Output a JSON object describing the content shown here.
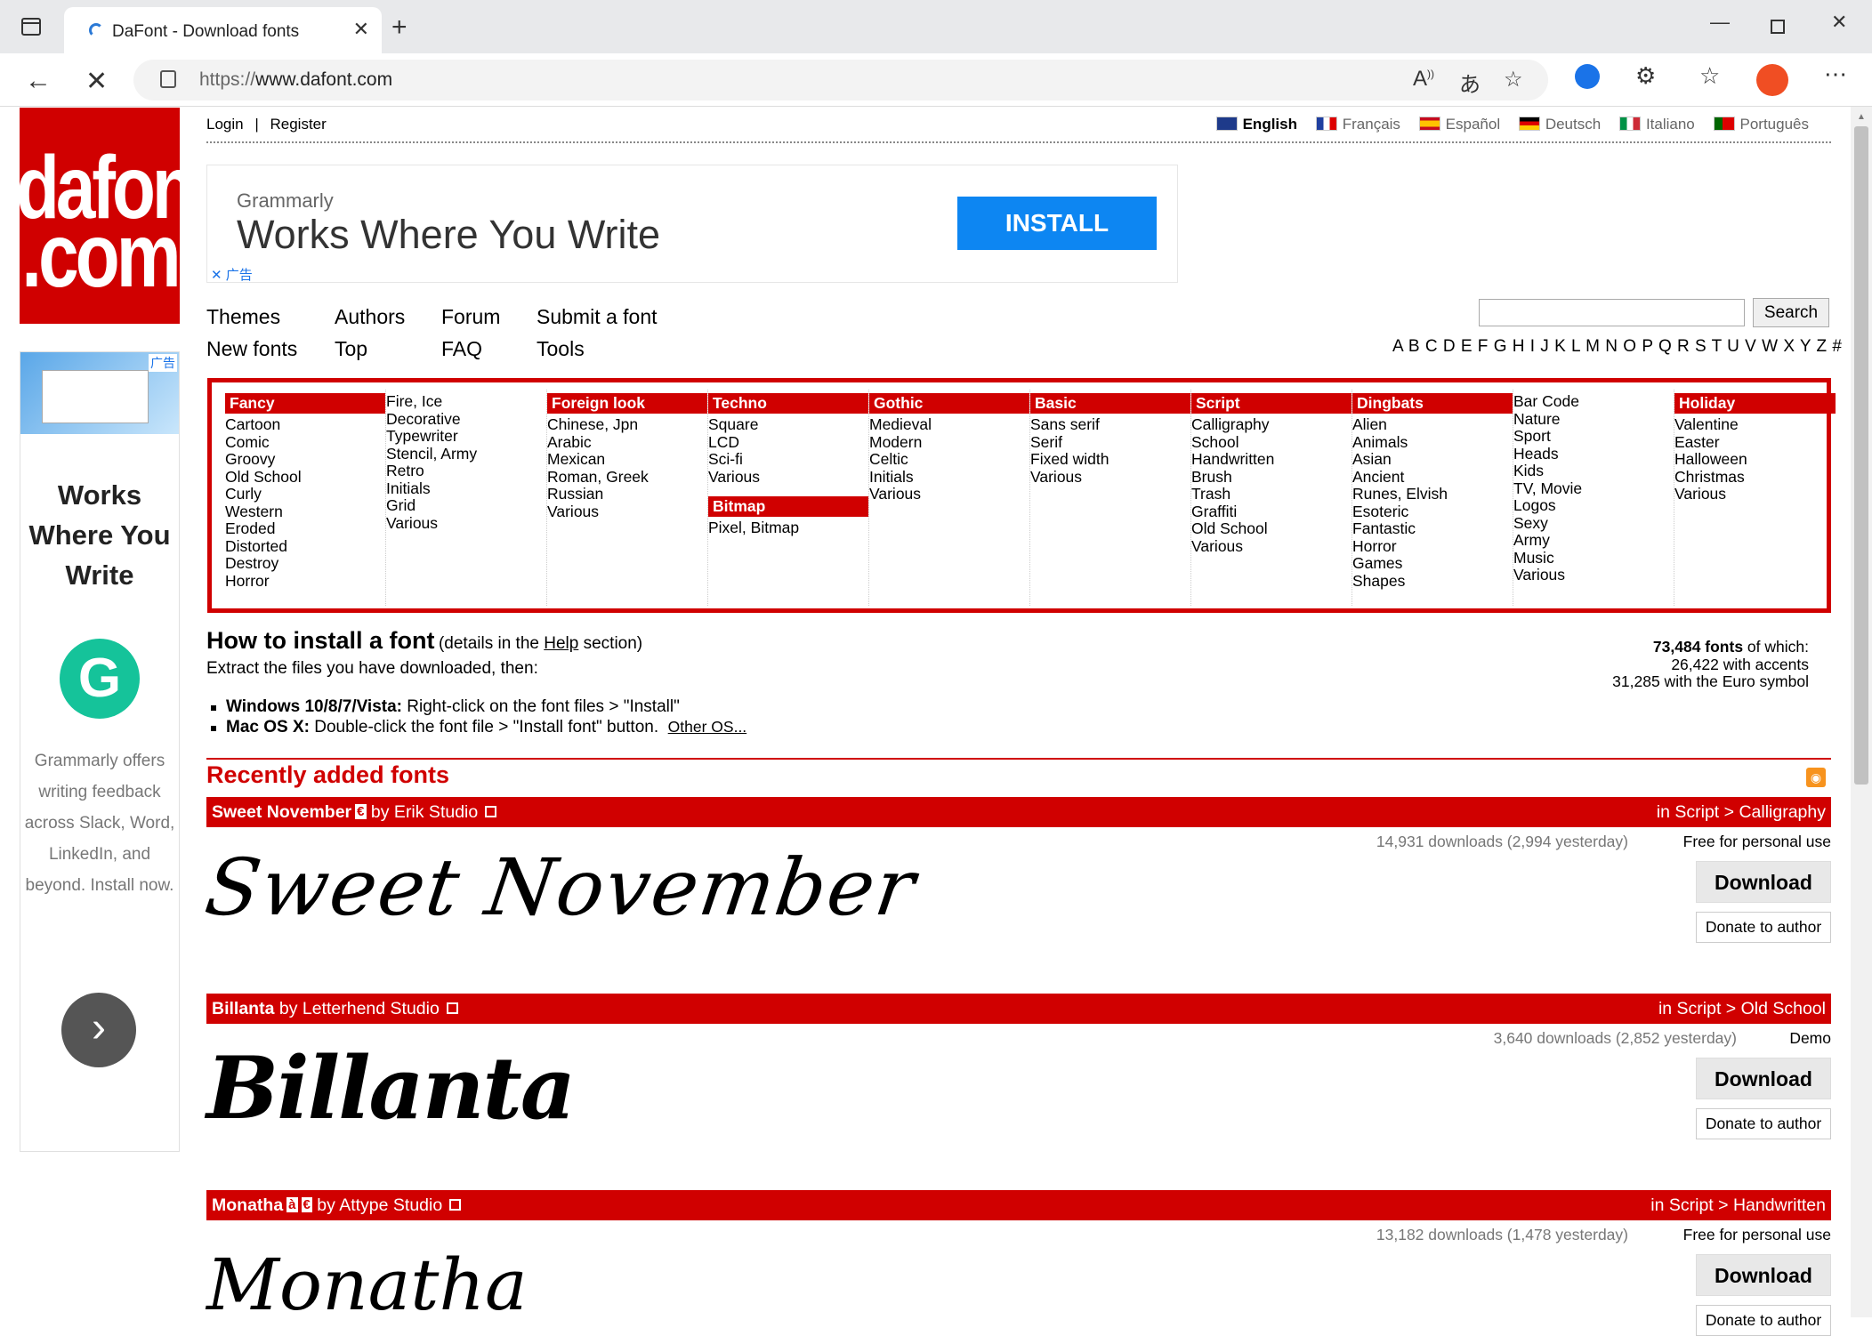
{
  "browser": {
    "tab_title": "DaFont - Download fonts",
    "url_proto": "https://",
    "url_host": "www.dafont.com"
  },
  "logo": {
    "line1": "dafont",
    "line2": ".com"
  },
  "side_ad": {
    "ad_tag": "广告",
    "headline": "Works Where You Write",
    "body": "Grammarly offers writing feedback across Slack, Word, LinkedIn, and beyond. Install now."
  },
  "top_links": {
    "login": "Login",
    "sep": "|",
    "register": "Register"
  },
  "languages": [
    "English",
    "Français",
    "Español",
    "Deutsch",
    "Italiano",
    "Português"
  ],
  "top_ad": {
    "brand": "Grammarly",
    "headline": "Works Where You Write",
    "button": "INSTALL",
    "ad_tag": "广告"
  },
  "nav": {
    "themes": "Themes",
    "new_fonts": "New fonts",
    "authors": "Authors",
    "top": "Top",
    "forum": "Forum",
    "faq": "FAQ",
    "submit": "Submit a font",
    "tools": "Tools"
  },
  "search": {
    "button": "Search",
    "value": ""
  },
  "alphabet": "A B C D E F G H I J K L M N O P Q R S T U V W X Y Z #",
  "categories": [
    {
      "sections": [
        {
          "title": "Fancy",
          "items": [
            "Cartoon",
            "Comic",
            "Groovy",
            "Old School",
            "Curly",
            "Western",
            "Eroded",
            "Distorted",
            "Destroy",
            "Horror"
          ]
        }
      ]
    },
    {
      "sections": [
        {
          "title": "",
          "items": [
            "Fire, Ice",
            "Decorative",
            "Typewriter",
            "Stencil, Army",
            "Retro",
            "Initials",
            "Grid",
            "Various"
          ]
        }
      ]
    },
    {
      "sections": [
        {
          "title": "Foreign look",
          "items": [
            "Chinese, Jpn",
            "Arabic",
            "Mexican",
            "Roman, Greek",
            "Russian",
            "Various"
          ]
        }
      ]
    },
    {
      "sections": [
        {
          "title": "Techno",
          "items": [
            "Square",
            "LCD",
            "Sci-fi",
            "Various"
          ]
        },
        {
          "title": "Bitmap",
          "items": [
            "Pixel, Bitmap"
          ]
        }
      ]
    },
    {
      "sections": [
        {
          "title": "Gothic",
          "items": [
            "Medieval",
            "Modern",
            "Celtic",
            "Initials",
            "Various"
          ]
        }
      ]
    },
    {
      "sections": [
        {
          "title": "Basic",
          "items": [
            "Sans serif",
            "Serif",
            "Fixed width",
            "Various"
          ]
        }
      ]
    },
    {
      "sections": [
        {
          "title": "Script",
          "items": [
            "Calligraphy",
            "School",
            "Handwritten",
            "Brush",
            "Trash",
            "Graffiti",
            "Old School",
            "Various"
          ]
        }
      ]
    },
    {
      "sections": [
        {
          "title": "Dingbats",
          "items": [
            "Alien",
            "Animals",
            "Asian",
            "Ancient",
            "Runes, Elvish",
            "Esoteric",
            "Fantastic",
            "Horror",
            "Games",
            "Shapes"
          ]
        }
      ]
    },
    {
      "sections": [
        {
          "title": "",
          "items": [
            "Bar Code",
            "Nature",
            "Sport",
            "Heads",
            "Kids",
            "TV, Movie",
            "Logos",
            "Sexy",
            "Army",
            "Music",
            "Various"
          ]
        }
      ]
    },
    {
      "sections": [
        {
          "title": "Holiday",
          "items": [
            "Valentine",
            "Easter",
            "Halloween",
            "Christmas",
            "Various"
          ]
        }
      ]
    }
  ],
  "howto": {
    "title": "How to install a font",
    "details_pre": "(details in the ",
    "details_link": "Help",
    "details_post": " section)",
    "extract": "Extract the files you have downloaded, then:",
    "win_label": "Windows 10/8/7/Vista:",
    "win_text": " Right-click on the font files > \"Install\"",
    "mac_label": "Mac OS X:",
    "mac_text": " Double-click the font file > \"Install font\" button.",
    "other": "Other OS..."
  },
  "stats": {
    "count": "73,484 fonts",
    "of_which": " of which:",
    "accents": "26,422 with accents",
    "euro": "31,285 with the Euro symbol"
  },
  "recent_title": "Recently added fonts",
  "fonts": [
    {
      "name": "Sweet November",
      "badges": [
        "€"
      ],
      "by": "by Erik Studio",
      "category": "in Script > Calligraphy",
      "downloads": "14,931 downloads (2,994 yesterday)",
      "license": "Free for personal use",
      "download": "Download",
      "donate": "Donate to author",
      "preview": "Sweet November"
    },
    {
      "name": "Billanta",
      "badges": [],
      "by": "by Letterhend Studio",
      "category": "in Script > Old School",
      "downloads": "3,640 downloads (2,852 yesterday)",
      "license": "Demo",
      "download": "Download",
      "donate": "Donate to author",
      "preview": "Billanta"
    },
    {
      "name": "Monatha",
      "badges": [
        "à",
        "€"
      ],
      "by": "by Attype Studio",
      "category": "in Script > Handwritten",
      "downloads": "13,182 downloads (1,478 yesterday)",
      "license": "Free for personal use",
      "download": "Download",
      "donate": "Donate to author",
      "preview": "Monatha"
    }
  ],
  "colors": {
    "brand_red": "#d00000",
    "install_blue": "#0d86f2",
    "grammarly_green": "#15c39a"
  }
}
